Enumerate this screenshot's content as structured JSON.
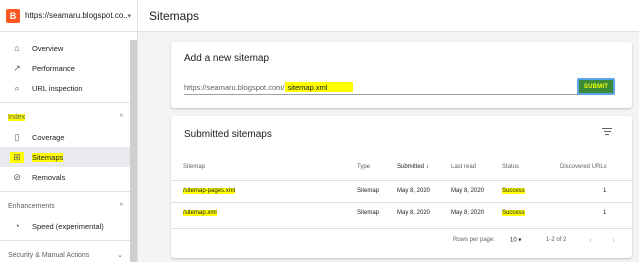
{
  "property": {
    "logo": "B",
    "url": "https://seamaru.blogspot.co...",
    "caret": "▾"
  },
  "nav": {
    "overview": "Overview",
    "performance": "Performance",
    "url_inspection": "URL inspection",
    "index_section": "Index",
    "coverage": "Coverage",
    "sitemaps": "Sitemaps",
    "removals": "Removals",
    "enhancements_section": "Enhancements",
    "speed": "Speed (experimental)",
    "security_section": "Security & Manual Actions",
    "collapse_glyph": "^",
    "expand_glyph": "⌄"
  },
  "header": {
    "title": "Sitemaps"
  },
  "add_sitemap": {
    "title": "Add a new sitemap",
    "prefix": "https://seamaru.blogspot.com/",
    "value": "sitemap.xml",
    "submit_label": "SUBMIT"
  },
  "submitted": {
    "title": "Submitted sitemaps",
    "columns": {
      "sitemap": "Sitemap",
      "type": "Type",
      "submitted": "Submitted",
      "sort_arrow": "↓",
      "last_read": "Last read",
      "status": "Status",
      "discovered": "Discovered URLs"
    },
    "rows": [
      {
        "sitemap": "/sitemap-pages.xml",
        "type": "Sitemap",
        "submitted": "May 8, 2020",
        "last_read": "May 8, 2020",
        "status": "Success",
        "discovered": "1"
      },
      {
        "sitemap": "/sitemap.xml",
        "type": "Sitemap",
        "submitted": "May 8, 2020",
        "last_read": "May 8, 2020",
        "status": "Success",
        "discovered": "1"
      }
    ],
    "footer": {
      "rows_per_page": "Rows per page:",
      "rows_value": "10",
      "dropdown": "▾",
      "range": "1-2 of 2",
      "prev": "‹",
      "next": "›"
    }
  },
  "colors": {
    "highlight": "#ffff00",
    "submit_bg": "#3c8b3a",
    "submit_text": "#f4ff00",
    "logo": "#ff5722"
  }
}
